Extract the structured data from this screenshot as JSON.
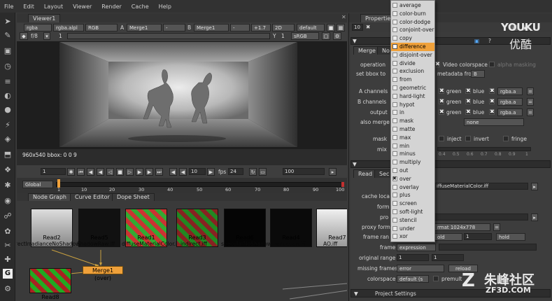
{
  "menubar": [
    "File",
    "Edit",
    "Layout",
    "Viewer",
    "Render",
    "Cache",
    "Help"
  ],
  "viewer": {
    "tab": "Viewer1",
    "row1": {
      "channels": "rgba",
      "alpha": "rgba.alpl",
      "display": "RGB",
      "a_label": "A",
      "a_input": "Merge1",
      "a_sub": "-",
      "b_label": "B",
      "b_input": "Merge1",
      "b_sub": "-",
      "gain": "+1.7",
      "view": "2D",
      "lut": "default"
    },
    "row2": {
      "fstop": "f/8",
      "frame": "1",
      "y": "Y",
      "y_val": "1",
      "lut2": "sRGB"
    },
    "status": "960x540 bbox: 0 0 9",
    "playback": {
      "start_frame": "1",
      "step": "10",
      "fps_label": "fps",
      "fps": "24",
      "end_frame": "100",
      "global": "Global",
      "ruler": [
        "1",
        "10",
        "20",
        "30",
        "40",
        "50",
        "60",
        "70",
        "80",
        "90",
        "100"
      ]
    }
  },
  "nodegraph": {
    "tabs": [
      "Node Graph",
      "Curve Editor",
      "Dope Sheet"
    ],
    "nodes": [
      {
        "label": "Read2",
        "sub": "rectIrradianceNoShadow.i"
      },
      {
        "label": "Read5",
        "sub": "ShadowRaw.iff"
      },
      {
        "label": "Read1",
        "sub": "diffuseMaterialColor.iff"
      },
      {
        "label": "Read3",
        "sub": "indirect.iff"
      },
      {
        "label": "Read6",
        "sub": "specularNoShadow.i"
      },
      {
        "label": "Read4",
        "sub": "reflection.iff"
      },
      {
        "label": "Read7",
        "sub": "AO.iff"
      },
      {
        "label": "Read8",
        "sub": ""
      }
    ],
    "merge": "Merge1 (over)"
  },
  "properties": {
    "title": "Properties",
    "max_panels": "10",
    "merge_tabs": [
      "Merge",
      "No"
    ],
    "operation_label": "operation",
    "video_colorspace": "Video colorspace",
    "alpha_masking": "alpha masking",
    "set_bbox_label": "set bbox to",
    "metadata_from": "metadata from",
    "metadata_val": "B",
    "a_channels": "A channels",
    "b_channels": "B channels",
    "output": "output",
    "also_merge": "also merge",
    "also_merge_val": "none",
    "green": "green",
    "blue": "blue",
    "rgba_a": "rgba.a",
    "mask_label": "mask",
    "inject": "inject",
    "invert": "invert",
    "fringe": "fringe",
    "mix_label": "mix",
    "mix_ticks": [
      "0.4",
      "0.5",
      "0.6",
      "0.7",
      "0.8",
      "0.9",
      "1"
    ],
    "read_tabs": [
      "Read",
      "Sec"
    ],
    "file_val": "iffuseMaterialColor.iff",
    "cache_locally": "cache loca",
    "format_label": "form",
    "proxy_label": "pro",
    "proxy_format_label": "proxy form",
    "proxy_format_val": "rmat 1024x778",
    "frame_range_label": "frame ran",
    "frame_range_a": "old",
    "frame_range_b": "1",
    "frame_range_c": "hold",
    "frame_label": "frame",
    "frame_val": "expression",
    "original_range_label": "original range",
    "original_range_a": "1",
    "original_range_b": "1",
    "missing_frames_label": "missing frames",
    "missing_frames_val": "error",
    "reload": "reload",
    "colorspace_label": "colorspace",
    "colorspace_val": "default (s",
    "premult": "premult",
    "project_settings": "Project Settings"
  },
  "blend_menu": {
    "items": [
      "average",
      "color-burn",
      "color-dodge",
      "conjoint-over",
      "copy",
      "difference",
      "disjoint-over",
      "divide",
      "exclusion",
      "from",
      "geometric",
      "hard-light",
      "hypot",
      "in",
      "mask",
      "matte",
      "max",
      "min",
      "minus",
      "multiply",
      "out",
      "over",
      "overlay",
      "plus",
      "screen",
      "soft-light",
      "stencil",
      "under",
      "xor"
    ],
    "highlighted": "difference",
    "checked": "over"
  },
  "watermarks": {
    "youku": "YOUKU",
    "youku_cn": "优酷",
    "zf_cn": "朱峰社区",
    "zf_url": "ZF3D.COM"
  },
  "colors": {
    "highlight": "#f0a13a",
    "node_selected": "#f0a13a",
    "bg": "#3a3a3a"
  }
}
